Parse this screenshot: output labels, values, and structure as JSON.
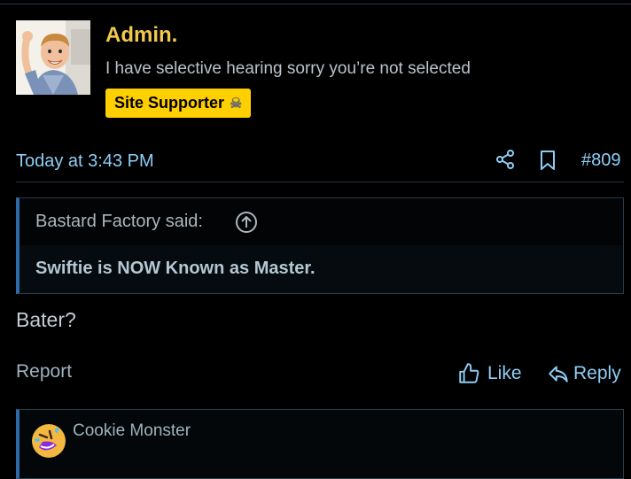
{
  "post": {
    "username": "Admin.",
    "user_title": "I have selective hearing sorry you’re not selected",
    "badge": {
      "label": "Site Supporter",
      "icon": "skull-crossbones-icon",
      "color": "#ffd000"
    },
    "date": "Today at 3:43 PM",
    "post_number": "#809",
    "quote": {
      "author_label": "Bastard Factory said:",
      "text": "Swiftie is NOW Known as Master."
    },
    "message": "Bater?",
    "actions": {
      "report": "Report",
      "like": "Like",
      "reply": "Reply"
    },
    "reactions": {
      "emoji": "rolling-on-floor-laughing-icon",
      "users": "Cookie Monster"
    }
  },
  "colors": {
    "background": "#000000",
    "username": "#f2c94c",
    "link": "#8ecdf4",
    "quote_border": "#2d6aa8"
  }
}
